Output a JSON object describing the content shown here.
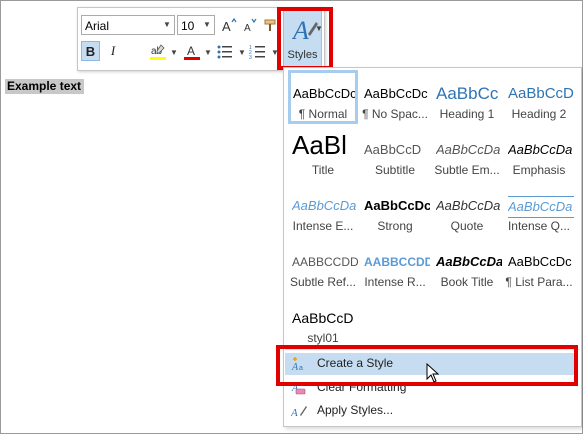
{
  "document": {
    "example_text": "Example text"
  },
  "toolbar": {
    "font_name": "Arial",
    "font_size": "10",
    "bold_label": "B",
    "italic_label": "I",
    "underline_label": "U",
    "styles_label": "Styles",
    "highlight_color": "#ffff00",
    "font_color": "#e00000"
  },
  "styles_gallery": {
    "tiles": [
      {
        "sample": "AaBbCcDc",
        "name": "¶ Normal",
        "selected": true
      },
      {
        "sample": "AaBbCcDc",
        "name": "¶ No Spac..."
      },
      {
        "sample": "AaBbCc",
        "name": "Heading 1"
      },
      {
        "sample": "AaBbCcD",
        "name": "Heading 2"
      },
      {
        "sample": "AaBl",
        "name": "Title"
      },
      {
        "sample": "AaBbCcD",
        "name": "Subtitle"
      },
      {
        "sample": "AaBbCcDa",
        "name": "Subtle Em..."
      },
      {
        "sample": "AaBbCcDa",
        "name": "Emphasis"
      },
      {
        "sample": "AaBbCcDa",
        "name": "Intense E..."
      },
      {
        "sample": "AaBbCcDc",
        "name": "Strong"
      },
      {
        "sample": "AaBbCcDa",
        "name": "Quote"
      },
      {
        "sample": "AaBbCcDa",
        "name": "Intense Q..."
      },
      {
        "sample": "AABBCCDD",
        "name": "Subtle Ref..."
      },
      {
        "sample": "AABBCCDD",
        "name": "Intense R..."
      },
      {
        "sample": "AaBbCcDa",
        "name": "Book Title"
      },
      {
        "sample": "AaBbCcDc",
        "name": "¶ List Para..."
      },
      {
        "sample": "AaBbCcD",
        "name": "styl01"
      }
    ]
  },
  "menu": {
    "create_style": "Create a Style",
    "clear_formatting": "Clear Formatting",
    "apply_styles": "Apply Styles..."
  },
  "colors": {
    "highlight_frame": "#e00000",
    "selection_blue": "#c5dcf1",
    "heading_blue": "#2e74b5"
  }
}
